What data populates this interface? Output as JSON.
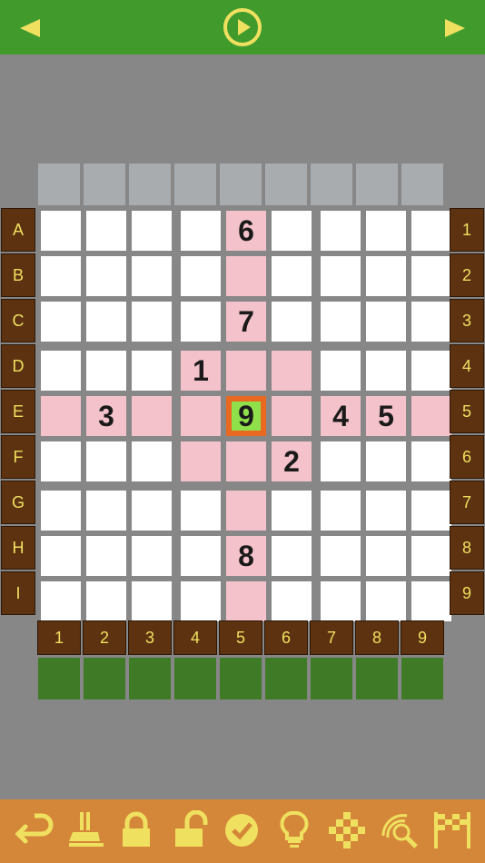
{
  "colors": {
    "topbar": "#409a2c",
    "accent": "#f0e060",
    "background": "#878787",
    "label_bg": "#5c3210",
    "highlight": "#f4c2cb",
    "selected_outer": "#e8691f",
    "selected_inner": "#8fe04a",
    "toolbar": "#d48738",
    "progress_cell": "#3f7a27"
  },
  "topbar": {
    "icons": [
      "prev-arrow-icon",
      "play-circle-icon",
      "next-arrow-icon"
    ]
  },
  "row_labels": [
    "A",
    "B",
    "C",
    "D",
    "E",
    "F",
    "G",
    "H",
    "I"
  ],
  "row_numbers": [
    "1",
    "2",
    "3",
    "4",
    "5",
    "6",
    "7",
    "8",
    "9"
  ],
  "col_labels": [
    "1",
    "2",
    "3",
    "4",
    "5",
    "6",
    "7",
    "8",
    "9"
  ],
  "grid": [
    [
      "",
      "",
      "",
      "",
      "6",
      "",
      "",
      "",
      ""
    ],
    [
      "",
      "",
      "",
      "",
      "",
      "",
      "",
      "",
      ""
    ],
    [
      "",
      "",
      "",
      "",
      "7",
      "",
      "",
      "",
      ""
    ],
    [
      "",
      "",
      "",
      "1",
      "",
      "",
      "",
      "",
      ""
    ],
    [
      "",
      "3",
      "",
      "",
      "9",
      "",
      "4",
      "5",
      ""
    ],
    [
      "",
      "",
      "",
      "",
      "",
      "2",
      "",
      "",
      ""
    ],
    [
      "",
      "",
      "",
      "",
      "",
      "",
      "",
      "",
      ""
    ],
    [
      "",
      "",
      "",
      "",
      "8",
      "",
      "",
      "",
      ""
    ],
    [
      "",
      "",
      "",
      "",
      "",
      "",
      "",
      "",
      ""
    ]
  ],
  "selected": {
    "row": 4,
    "col": 4
  },
  "toolbar": {
    "icons": [
      "undo-icon",
      "eraser-icon",
      "lock-icon",
      "unlock-icon",
      "check-icon",
      "hint-bulb-icon",
      "grid-icon",
      "magnifier-icon",
      "finish-flag-icon"
    ]
  }
}
